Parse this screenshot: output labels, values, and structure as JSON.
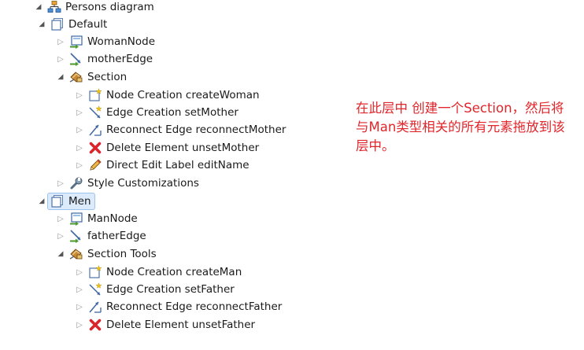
{
  "tree": {
    "root": {
      "label": "Persons diagram",
      "icon": "diagram-icon"
    },
    "default_layer": {
      "label": "Default",
      "icon": "layer-icon",
      "items": [
        {
          "label": "WomanNode",
          "icon": "node-mapping-icon"
        },
        {
          "label": "motherEdge",
          "icon": "edge-mapping-icon"
        }
      ],
      "section": {
        "label": "Section",
        "icon": "tool-section-icon",
        "tools": [
          {
            "label": "Node Creation createWoman",
            "icon": "node-creation-icon"
          },
          {
            "label": "Edge Creation setMother",
            "icon": "edge-creation-icon"
          },
          {
            "label": "Reconnect Edge reconnectMother",
            "icon": "reconnect-edge-icon"
          },
          {
            "label": "Delete Element unsetMother",
            "icon": "delete-element-icon"
          },
          {
            "label": "Direct Edit Label editName",
            "icon": "direct-edit-label-icon"
          }
        ]
      },
      "style": {
        "label": "Style Customizations",
        "icon": "wrench-icon"
      }
    },
    "men_layer": {
      "label": "Men",
      "icon": "layer-icon",
      "items": [
        {
          "label": "ManNode",
          "icon": "node-mapping-icon"
        },
        {
          "label": "fatherEdge",
          "icon": "edge-mapping-icon"
        }
      ],
      "section": {
        "label": "Section Tools",
        "icon": "tool-section-icon",
        "tools": [
          {
            "label": "Node Creation createMan",
            "icon": "node-creation-icon"
          },
          {
            "label": "Edge Creation setFather",
            "icon": "edge-creation-icon"
          },
          {
            "label": "Reconnect Edge reconnectFather",
            "icon": "reconnect-edge-icon"
          },
          {
            "label": "Delete Element unsetFather",
            "icon": "delete-element-icon"
          }
        ]
      }
    }
  },
  "annotation": {
    "text": "在此层中 创建一个Section，然后将与Man类型相关的所有元素拖放到该层中。"
  },
  "colors": {
    "annotation": "#e0262b",
    "selection_bg": "#dcebfb",
    "selection_border": "#9ec3ec"
  }
}
